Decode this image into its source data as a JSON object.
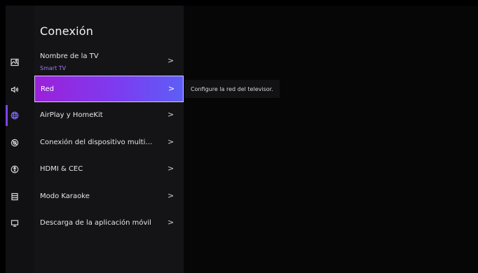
{
  "page_title": "Conexión",
  "menu": [
    {
      "label": "Nombre de la TV",
      "sublabel": "Smart TV",
      "chevron": ">"
    },
    {
      "label": "Red",
      "chevron": ">",
      "selected": true
    },
    {
      "label": "AirPlay y HomeKit",
      "chevron": ">"
    },
    {
      "label": "Conexión del dispositivo multi…",
      "chevron": ">"
    },
    {
      "label": "HDMI & CEC",
      "chevron": ">"
    },
    {
      "label": "Modo Karaoke",
      "chevron": ">"
    },
    {
      "label": "Descarga de la aplicación móvil",
      "chevron": ">"
    }
  ],
  "tooltip": "Configure la red del televisor.",
  "sidebar_icons": [
    "picture-icon",
    "sound-icon",
    "network-globe-icon",
    "privacy-icon",
    "accessibility-icon",
    "system-icon",
    "support-icon"
  ],
  "colors": {
    "accent_start": "#9b21d9",
    "accent_end": "#5d5ff5",
    "active_icon": "#7a67ff",
    "sublabel": "#9b7cff"
  }
}
